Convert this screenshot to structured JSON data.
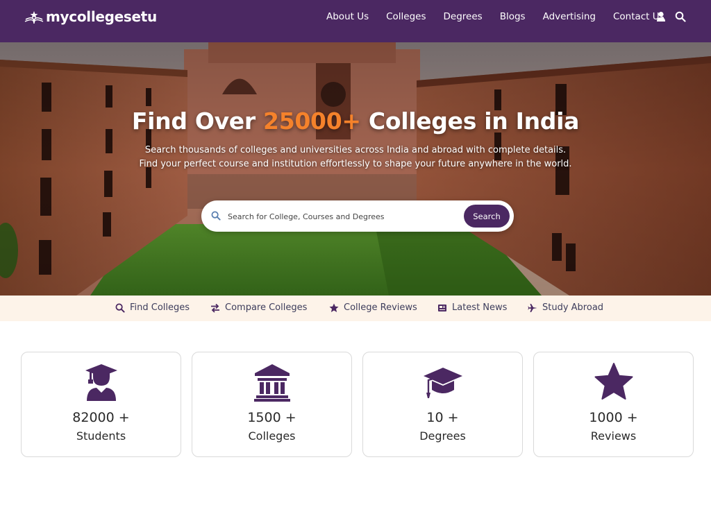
{
  "header": {
    "logo_text": "mycollegesetu",
    "nav": [
      "About Us",
      "Colleges",
      "Degrees",
      "Blogs",
      "Advertising",
      "Contact Us"
    ],
    "icons": [
      "user-icon",
      "search-icon"
    ]
  },
  "hero": {
    "title_before": "Find Over ",
    "title_highlight": "25000+",
    "title_after": " Colleges in India",
    "subtitle_line1": "Search thousands of colleges and universities across India and abroad with complete details.",
    "subtitle_line2": "Find your perfect course and institution effortlessly to shape your future anywhere in the world.",
    "search_placeholder": "Search for College, Courses and Degrees",
    "search_value": "",
    "search_button": "Search",
    "highlight_color": "#f5822b"
  },
  "quick_links": [
    {
      "label": "Find Colleges",
      "icon": "search-icon"
    },
    {
      "label": "Compare Colleges",
      "icon": "swap-arrows-icon"
    },
    {
      "label": "College Reviews",
      "icon": "star-icon"
    },
    {
      "label": "Latest News",
      "icon": "newspaper-icon"
    },
    {
      "label": "Study Abroad",
      "icon": "plane-icon"
    }
  ],
  "stats": [
    {
      "value": "82000 +",
      "label": "Students",
      "icon": "graduate-student-icon"
    },
    {
      "value": "1500 +",
      "label": "Colleges",
      "icon": "university-building-icon"
    },
    {
      "value": "10 +",
      "label": "Degrees",
      "icon": "graduation-cap-icon"
    },
    {
      "value": "1000 +",
      "label": "Reviews",
      "icon": "star-icon"
    }
  ],
  "colors": {
    "brand_purple": "#4b2862",
    "accent_orange": "#f5822b",
    "strip_background": "#fdf3e9"
  }
}
